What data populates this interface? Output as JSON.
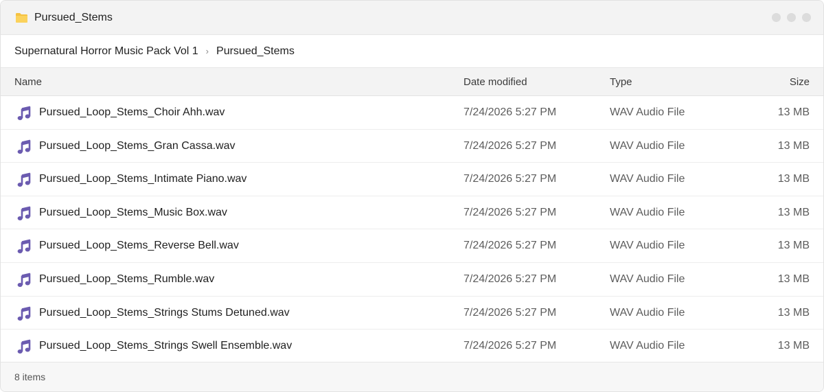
{
  "window": {
    "title": "Pursued_Stems",
    "icon": "folder-icon",
    "accent": "#f5c242"
  },
  "breadcrumb": {
    "items": [
      "Supernatural Horror Music Pack Vol 1",
      "Pursued_Stems"
    ],
    "separator": "›"
  },
  "columns": {
    "name": "Name",
    "date": "Date modified",
    "type": "Type",
    "size": "Size"
  },
  "files": [
    {
      "name": "Pursued_Loop_Stems_Choir Ahh.wav",
      "date": "7/24/2026 5:27 PM",
      "type": "WAV Audio File",
      "size": "13 MB"
    },
    {
      "name": "Pursued_Loop_Stems_Gran Cassa.wav",
      "date": "7/24/2026 5:27 PM",
      "type": "WAV Audio File",
      "size": "13 MB"
    },
    {
      "name": "Pursued_Loop_Stems_Intimate Piano.wav",
      "date": "7/24/2026 5:27 PM",
      "type": "WAV Audio File",
      "size": "13 MB"
    },
    {
      "name": "Pursued_Loop_Stems_Music Box.wav",
      "date": "7/24/2026 5:27 PM",
      "type": "WAV Audio File",
      "size": "13 MB"
    },
    {
      "name": "Pursued_Loop_Stems_Reverse Bell.wav",
      "date": "7/24/2026 5:27 PM",
      "type": "WAV Audio File",
      "size": "13 MB"
    },
    {
      "name": "Pursued_Loop_Stems_Rumble.wav",
      "date": "7/24/2026 5:27 PM",
      "type": "WAV Audio File",
      "size": "13 MB"
    },
    {
      "name": "Pursued_Loop_Stems_Strings Stums Detuned.wav",
      "date": "7/24/2026 5:27 PM",
      "type": "WAV Audio File",
      "size": "13 MB"
    },
    {
      "name": "Pursued_Loop_Stems_Strings Swell Ensemble.wav",
      "date": "7/24/2026 5:27 PM",
      "type": "WAV Audio File",
      "size": "13 MB"
    }
  ],
  "file_icon": "music-note-icon",
  "file_icon_color": "#6b5bb0",
  "status": {
    "item_count": "8 items"
  }
}
